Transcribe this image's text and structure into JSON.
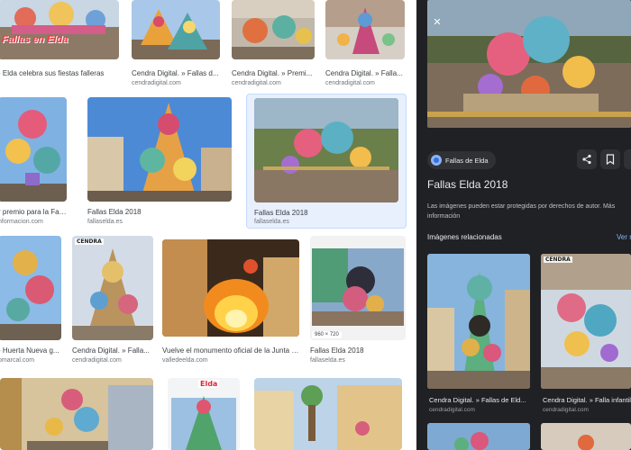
{
  "results": {
    "row1": [
      {
        "caption": "- Elda celebra sus fiestas falleras",
        "source": "",
        "overlay": "Fallas en Elda"
      },
      {
        "caption": "Cendra Digital. » Fallas d...",
        "source": "cendradigital.com"
      },
      {
        "caption": "Cendra Digital. » Premi...",
        "source": "cendradigital.com"
      },
      {
        "caption": "Cendra Digital. » Falla...",
        "source": "cendradigital.com"
      }
    ],
    "row2": [
      {
        "caption": "r premio para la Fall...",
        "source": "nformacion.com"
      },
      {
        "caption": "Fallas Elda 2018",
        "source": "fallaselda.es"
      },
      {
        "caption": "Fallas Elda 2018",
        "source": "fallaselda.es"
      }
    ],
    "row3": [
      {
        "caption": "- Huerta Nueva g...",
        "source": "omarcal.com"
      },
      {
        "caption": "Cendra Digital. » Falla...",
        "source": "cendradigital.com",
        "tag": "CENDRA"
      },
      {
        "caption": "Vuelve el monumento oficial de la Junta C...",
        "source": "valledeelda.com"
      },
      {
        "caption": "Fallas Elda 2018",
        "source": "fallaselda.es",
        "size": "960 × 720"
      }
    ],
    "row4_overlay": "Elda"
  },
  "panel": {
    "close_icon": "close-icon",
    "site_name": "Fallas de Elda",
    "title": "Fallas Elda 2018",
    "copyright_note": "Las imágenes pueden estar protegidas por derechos de autor. Más información",
    "related_heading": "Imágenes relacionadas",
    "see_more": "Ver m",
    "related": [
      {
        "caption": "Cendra Digital. » Fallas de Eld...",
        "source": "cendradigital.com"
      },
      {
        "caption": "Cendra Digital. » Falla infantil",
        "source": "cendradigital.com",
        "tag": "CENDRA"
      }
    ]
  },
  "colors": {
    "panel_bg": "#202124",
    "link_blue": "#8ab4f8",
    "selected_bg": "#e8f0fe"
  }
}
